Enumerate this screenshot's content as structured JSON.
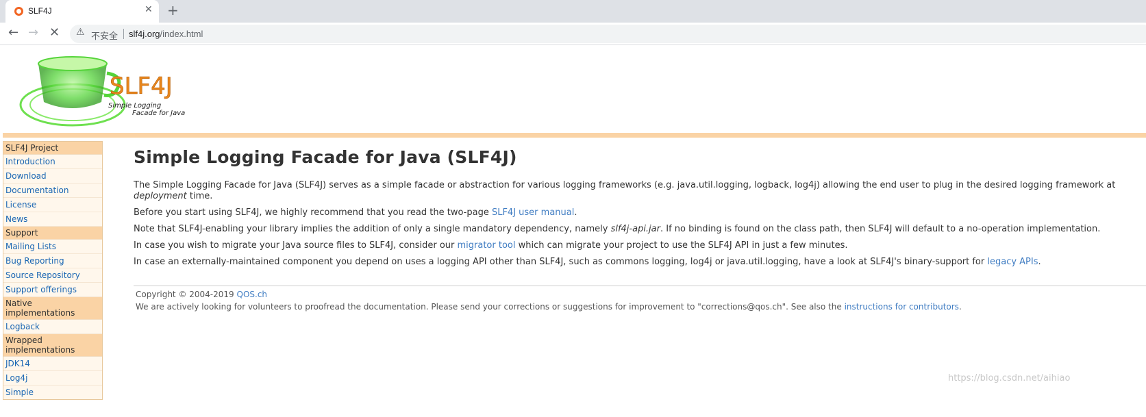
{
  "browser": {
    "tab_title": "SLF4J",
    "insecure_label": "不安全",
    "url_host": "slf4j.org",
    "url_path": "/index.html"
  },
  "logo": {
    "main": "SLF4J",
    "line1": "Simple Logging",
    "line2": "Facade for Java"
  },
  "sidebar": {
    "sections": [
      {
        "title": "SLF4J Project",
        "items": [
          "Introduction",
          "Download",
          "Documentation",
          "License",
          "News"
        ]
      },
      {
        "title": "Support",
        "items": [
          "Mailing Lists",
          "Bug Reporting",
          "Source Repository",
          "Support offerings"
        ]
      },
      {
        "title": "Native implementations",
        "items": [
          "Logback"
        ]
      },
      {
        "title": "Wrapped implementations",
        "items": [
          "JDK14",
          "Log4j",
          "Simple"
        ]
      }
    ]
  },
  "main": {
    "heading": "Simple Logging Facade for Java (SLF4J)",
    "p1_text": "The Simple Logging Facade for Java (SLF4J) serves as a simple facade or abstraction for various logging frameworks (e.g. java.util.logging, logback, log4j) allowing the end user to plug in the desired logging framework at",
    "p1_em": "deployment",
    "p1_end": " time.",
    "p2_text": "Before you start using SLF4J, we highly recommend that you read the two-page ",
    "p2_link": "SLF4J user manual",
    "p2_end": ".",
    "p3_text": "Note that SLF4J-enabling your library implies the addition of only a single mandatory dependency, namely ",
    "p3_em": "slf4j-api.jar",
    "p3_end": ". If no binding is found on the class path, then SLF4J will default to a no-operation implementation.",
    "p4_text": "In case you wish to migrate your Java source files to SLF4J, consider our ",
    "p4_link": "migrator tool",
    "p4_end": " which can migrate your project to use the SLF4J API in just a few minutes.",
    "p5_text": "In case an externally-maintained component you depend on uses a logging API other than SLF4J, such as commons logging, log4j or java.util.logging, have a look at SLF4J's binary-support for ",
    "p5_link": "legacy APIs",
    "p5_end": "."
  },
  "footer": {
    "copyright": "Copyright © 2004-2019 ",
    "copyright_link": "QOS.ch",
    "line2": "We are actively looking for volunteers to proofread the documentation. Please send your corrections or suggestions for improvement to \"corrections@qos.ch\". See also the ",
    "line2_link": "instructions for contributors",
    "line2_end": "."
  },
  "watermark": "https://blog.csdn.net/aihiao",
  "colors": {
    "accent_orange": "#fad3a5",
    "link_blue": "#3f7cc2",
    "logo_orange": "#e8871e",
    "logo_green": "#55d43a"
  }
}
